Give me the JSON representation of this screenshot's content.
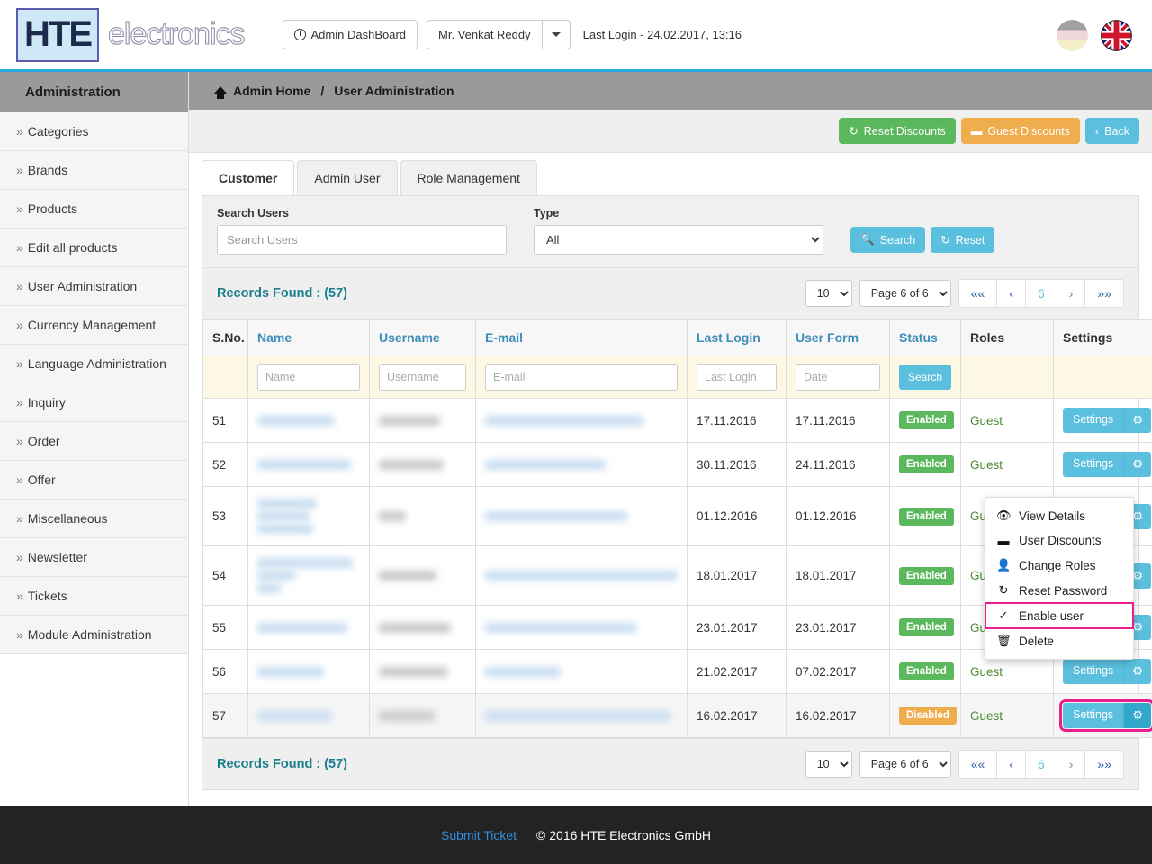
{
  "header": {
    "logo_mark": "HTE",
    "logo_word": "electronics",
    "dashboard_button": "Admin DashBoard",
    "user_name": "Mr. Venkat Reddy",
    "last_login": "Last Login - 24.02.2017, 13:16",
    "flag_inactive": "german-flag",
    "flag_active": "uk-flag",
    "clock_icon": "clock-icon"
  },
  "sidebar": {
    "title": "Administration",
    "items": [
      {
        "label": "Categories"
      },
      {
        "label": "Brands"
      },
      {
        "label": "Products"
      },
      {
        "label": "Edit all products"
      },
      {
        "label": "User Administration"
      },
      {
        "label": "Currency Management"
      },
      {
        "label": "Language Administration"
      },
      {
        "label": "Inquiry"
      },
      {
        "label": "Order"
      },
      {
        "label": "Offer"
      },
      {
        "label": "Miscellaneous"
      },
      {
        "label": "Newsletter"
      },
      {
        "label": "Tickets"
      },
      {
        "label": "Module Administration"
      }
    ]
  },
  "breadcrumb": {
    "home": "Admin Home",
    "separator": "/",
    "current": "User Administration"
  },
  "actions": {
    "reset_discounts": "Reset Discounts",
    "guest_discounts": "Guest Discounts",
    "back": "Back"
  },
  "tabs": [
    {
      "label": "Customer",
      "active": true
    },
    {
      "label": "Admin User",
      "active": false
    },
    {
      "label": "Role Management",
      "active": false
    }
  ],
  "search": {
    "users_label": "Search Users",
    "users_placeholder": "Search Users",
    "users_value": "",
    "type_label": "Type",
    "type_value": "All",
    "search_button": "Search",
    "reset_button": "Reset"
  },
  "records": {
    "label": "Records Found : (57)",
    "page_size": "10",
    "page_of": "Page 6 of 6",
    "current_page": "6",
    "first_label": "««",
    "prev_label": "‹",
    "next_label": "›",
    "last_label": "»»"
  },
  "table": {
    "columns": [
      "S.No.",
      "Name",
      "Username",
      "E-mail",
      "Last Login",
      "User Form",
      "Status",
      "Roles",
      "Settings"
    ],
    "filters": {
      "name_placeholder": "Name",
      "username_placeholder": "Username",
      "email_placeholder": "E-mail",
      "last_login_placeholder": "Last Login",
      "user_form_placeholder": "Date",
      "search_button": "Search"
    },
    "rows": [
      {
        "sno": "51",
        "last_login": "17.11.2016",
        "user_form": "17.11.2016",
        "status": "Enabled",
        "role": "Guest",
        "settings": "Settings"
      },
      {
        "sno": "52",
        "last_login": "30.11.2016",
        "user_form": "24.11.2016",
        "status": "Enabled",
        "role": "Guest",
        "settings": "Settings"
      },
      {
        "sno": "53",
        "last_login": "01.12.2016",
        "user_form": "01.12.2016",
        "status": "Enabled",
        "role": "Guest",
        "settings": "Settings"
      },
      {
        "sno": "54",
        "last_login": "18.01.2017",
        "user_form": "18.01.2017",
        "status": "Enabled",
        "role": "Guest",
        "settings": "Settings"
      },
      {
        "sno": "55",
        "last_login": "23.01.2017",
        "user_form": "23.01.2017",
        "status": "Enabled",
        "role": "Guest",
        "settings": "Settings"
      },
      {
        "sno": "56",
        "last_login": "21.02.2017",
        "user_form": "07.02.2017",
        "status": "Enabled",
        "role": "Guest",
        "settings": "Settings"
      },
      {
        "sno": "57",
        "last_login": "16.02.2017",
        "user_form": "16.02.2017",
        "status": "Disabled",
        "role": "Guest",
        "settings": "Settings"
      }
    ]
  },
  "context_menu": {
    "items": [
      {
        "label": "View Details",
        "icon": "eye-icon",
        "glyph": "◉",
        "highlighted": false
      },
      {
        "label": "User Discounts",
        "icon": "minus-icon",
        "glyph": "➖",
        "highlighted": false
      },
      {
        "label": "Change Roles",
        "icon": "user-icon",
        "glyph": "👤",
        "highlighted": false
      },
      {
        "label": "Reset Password",
        "icon": "refresh-icon",
        "glyph": "↻",
        "highlighted": false
      },
      {
        "label": "Enable user",
        "icon": "check-circle-icon",
        "glyph": "✓",
        "highlighted": true
      },
      {
        "label": "Delete",
        "icon": "trash-icon",
        "glyph": "🗑",
        "highlighted": false
      }
    ]
  },
  "footer": {
    "submit_ticket": "Submit Ticket",
    "copyright": "© 2016 HTE Electronics GmbH"
  },
  "colors": {
    "accent_blue": "#5bc0de",
    "green": "#5cb85c",
    "orange": "#f0ad4e",
    "teal_text": "#1b7f8e",
    "highlight_pink": "#e91e8c",
    "header_underline": "#29abe2"
  }
}
